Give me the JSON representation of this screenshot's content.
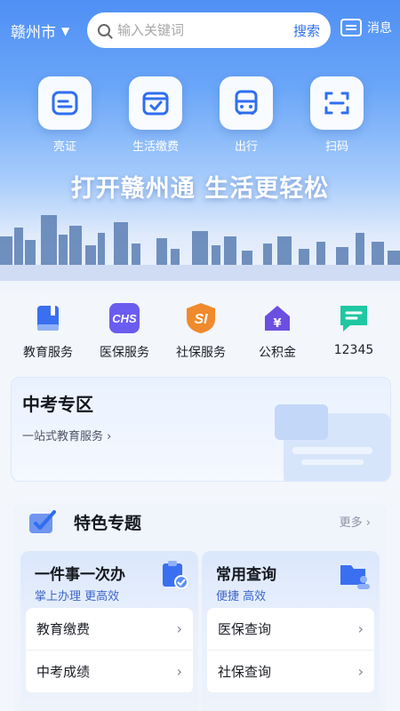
{
  "topbar": {
    "city": "赣州市",
    "search_placeholder": "输入关键词",
    "search_button": "搜索",
    "message_label": "消息"
  },
  "quick_actions": [
    {
      "label": "亮证",
      "icon": "card-icon"
    },
    {
      "label": "生活缴费",
      "icon": "wallet-icon"
    },
    {
      "label": "出行",
      "icon": "bus-icon"
    },
    {
      "label": "扫码",
      "icon": "scan-icon"
    }
  ],
  "banner": {
    "slogan": "打开赣州通 生活更轻松"
  },
  "services": [
    {
      "label": "教育服务",
      "icon": "book-icon",
      "color": "#3a6ff0"
    },
    {
      "label": "医保服务",
      "icon": "chs-icon",
      "color": "#6b5cf0",
      "badge": "CHS"
    },
    {
      "label": "社保服务",
      "icon": "si-icon",
      "color": "#f08a2c",
      "badge": "SI"
    },
    {
      "label": "公积金",
      "icon": "house-fund-icon",
      "color": "#6b4fe0"
    },
    {
      "label": "12345",
      "icon": "hotline-icon",
      "color": "#1fc8a2"
    }
  ],
  "zhongkao": {
    "title": "中考专区",
    "subtitle": "一站式教育服务"
  },
  "featured": {
    "title": "特色专题",
    "more": "更多",
    "cards": [
      {
        "title": "一件事一次办",
        "subtitle": "掌上办理 更高效",
        "items": [
          "教育缴费",
          "中考成绩"
        ]
      },
      {
        "title": "常用查询",
        "subtitle": "便捷 高效",
        "items": [
          "医保查询",
          "社保查询"
        ]
      }
    ]
  },
  "colors": {
    "primary": "#4f8ff5",
    "accent": "#2f6ef0"
  }
}
